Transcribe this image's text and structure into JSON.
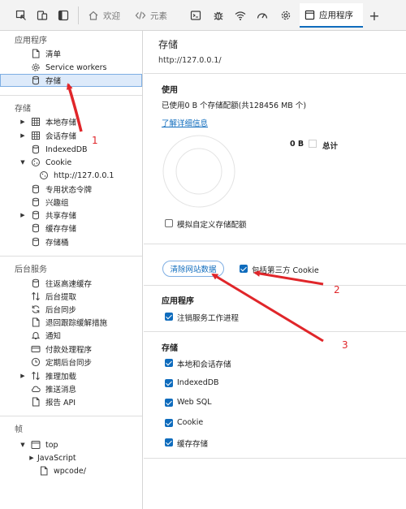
{
  "toolbar": {
    "tabs": [
      {
        "label": "欢迎",
        "icon": "home-icon"
      },
      {
        "label": "元素",
        "icon": "code-icon"
      },
      {
        "label": "应用程序",
        "icon": "application-icon"
      }
    ],
    "icons": [
      "inspect-icon",
      "device-toggle-icon",
      "sidebar-toggle-icon",
      "console-icon",
      "debug-bug-icon",
      "network-wifi-icon",
      "performance-gauge-icon",
      "settings-gear-icon",
      "add-tab-icon"
    ]
  },
  "sidebar": {
    "app_section": {
      "title": "应用程序",
      "items": [
        "清单",
        "Service workers",
        "存储"
      ]
    },
    "storage_section": {
      "title": "存储",
      "items": [
        "本地存储",
        "会话存储",
        "IndexedDB",
        "Cookie",
        "http://127.0.0.1",
        "专用状态令牌",
        "兴趣组",
        "共享存储",
        "缓存存储",
        "存储桶"
      ]
    },
    "bg_section": {
      "title": "后台服务",
      "items": [
        "往返高速缓存",
        "后台提取",
        "后台同步",
        "退回跟踪缓解措施",
        "通知",
        "付款处理程序",
        "定期后台同步",
        "推理加载",
        "推送消息",
        "报告 API"
      ]
    },
    "frames_section": {
      "title": "帧",
      "items": [
        "top",
        "JavaScript",
        "wpcode/"
      ]
    }
  },
  "main": {
    "title": "存储",
    "url": "http://127.0.0.1/",
    "usage": {
      "heading": "使用",
      "quota_text": "已使用0 B 个存储配额(共128456 MB 个)",
      "learn_more": "了解详细信息",
      "total_value": "0 B",
      "total_label": "总计",
      "simulate_label": "模拟自定义存储配额",
      "simulate_checked": false
    },
    "clear_button": "清除网站数据",
    "third_party_label": "包括第三方 Cookie",
    "third_party_checked": true,
    "application": {
      "heading": "应用程序",
      "items": [
        {
          "label": "注销服务工作进程",
          "checked": true
        }
      ]
    },
    "storage": {
      "heading": "存储",
      "items": [
        {
          "label": "本地和会话存储",
          "checked": true
        },
        {
          "label": "IndexedDB",
          "checked": true
        },
        {
          "label": "Web SQL",
          "checked": true
        },
        {
          "label": "Cookie",
          "checked": true
        },
        {
          "label": "缓存存储",
          "checked": true
        }
      ]
    }
  },
  "annotations": {
    "labels": [
      "1",
      "2",
      "3"
    ],
    "color": "#e0262a"
  },
  "colors": {
    "accent": "#0f6cbd",
    "selected_bg": "#ddeafa"
  }
}
